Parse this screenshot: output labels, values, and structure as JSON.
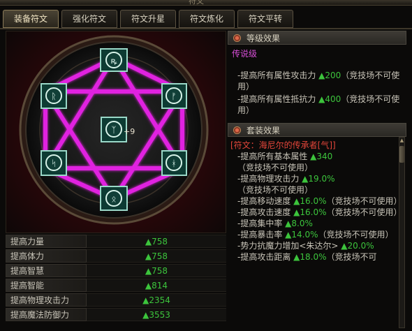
{
  "window": {
    "title": "符文"
  },
  "tabs": [
    {
      "label": "装备符文",
      "active": true
    },
    {
      "label": "强化符文",
      "active": false
    },
    {
      "label": "符文升星",
      "active": false
    },
    {
      "label": "符文炼化",
      "active": false
    },
    {
      "label": "符文平转",
      "active": false
    }
  ],
  "center_rune": {
    "level": "+9"
  },
  "stats": [
    {
      "name": "提高力量",
      "value": "▲758"
    },
    {
      "name": "提高体力",
      "value": "▲758"
    },
    {
      "name": "提高智慧",
      "value": "▲758"
    },
    {
      "name": "提高智能",
      "value": "▲814"
    },
    {
      "name": "提高物理攻击力",
      "value": "▲2354"
    },
    {
      "name": "提高魔法防御力",
      "value": "▲3553"
    }
  ],
  "level_effect": {
    "header": "等级效果",
    "grade": "传说级",
    "lines": [
      {
        "text": "-提高所有属性攻击力 ",
        "value": "▲200",
        "note": "（竞技场不可使用）"
      },
      {
        "text": "-提高所有属性抵抗力 ",
        "value": "▲400",
        "note": "（竞技场不可使用）"
      }
    ]
  },
  "set_effect": {
    "header": "套装效果",
    "set_name": "[符文：海尼尔的传承者[气]]",
    "lines": [
      {
        "text": "-提高所有基本属性 ",
        "value": "▲340",
        "note": "（竞技场不可使用）"
      },
      {
        "text": "-提高物理攻击力 ",
        "value": "▲19.0%",
        "note": "（竞技场不可使用）"
      },
      {
        "text": "-提高移动速度 ",
        "value": "▲16.0%",
        "note": "（竞技场不可使用）"
      },
      {
        "text": "-提高攻击速度 ",
        "value": "▲16.0%",
        "note": "（竞技场不可使用）"
      },
      {
        "text": "-提高集中率 ",
        "value": "▲8.0%",
        "note": ""
      },
      {
        "text": "-提高暴击率 ",
        "value": "▲14.0%",
        "note": "（竞技场不可使用）"
      },
      {
        "text": "-势力抗魔力增加<朱达尔> ",
        "value": "▲20.0%",
        "note": ""
      },
      {
        "text": "-提高攻击距离 ",
        "value": "▲18.0%",
        "note": "（竞技场不可"
      }
    ]
  },
  "colors": {
    "accent_magenta": "#e020e0",
    "positive_green": "#3cc43c",
    "set_name_red": "#e4463a"
  },
  "icons": {
    "header_bullet": "ruby-dot-icon",
    "scroll_up": "arrow-up-icon"
  }
}
